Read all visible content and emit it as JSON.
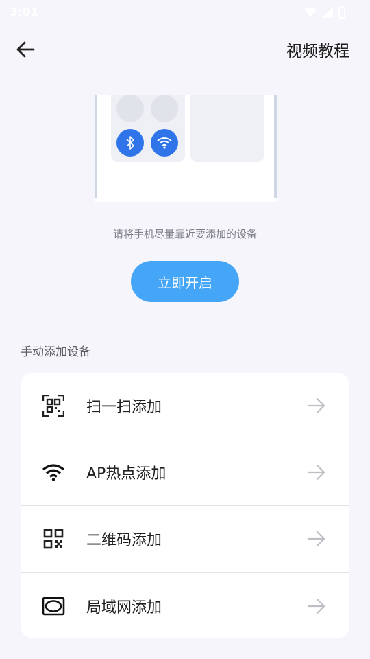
{
  "statusbar": {
    "time": "3:01"
  },
  "header": {
    "video_tutorial": "视频教程"
  },
  "main": {
    "hint": "请将手机尽量靠近要添加的设备",
    "open_now_label": "立即开启"
  },
  "manual_section": {
    "title": "手动添加设备",
    "items": [
      {
        "label": "扫一扫添加",
        "icon": "scan-qr-icon"
      },
      {
        "label": "AP热点添加",
        "icon": "wifi-icon"
      },
      {
        "label": "二维码添加",
        "icon": "qr-code-icon"
      },
      {
        "label": "局域网添加",
        "icon": "lan-icon"
      }
    ]
  },
  "colors": {
    "accent": "#45a6f7",
    "bluetooth_wifi": "#2f74e8",
    "background": "#f5f5fb"
  }
}
